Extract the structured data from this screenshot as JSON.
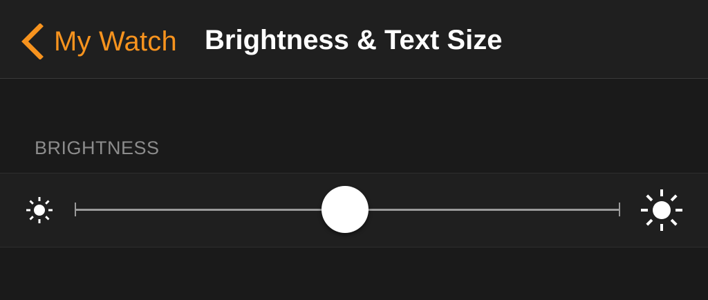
{
  "nav": {
    "back_label": "My Watch",
    "title": "Brightness & Text Size"
  },
  "brightness": {
    "section_header": "BRIGHTNESS",
    "level": 0.5
  },
  "icons": {
    "back": "chevron-left-icon",
    "min_brightness": "sun-small-icon",
    "max_brightness": "sun-large-icon"
  },
  "colors": {
    "accent": "#f7931e",
    "background": "#1a1a1a",
    "cell": "#1f1f1f",
    "header_text": "#8c8c8c"
  }
}
